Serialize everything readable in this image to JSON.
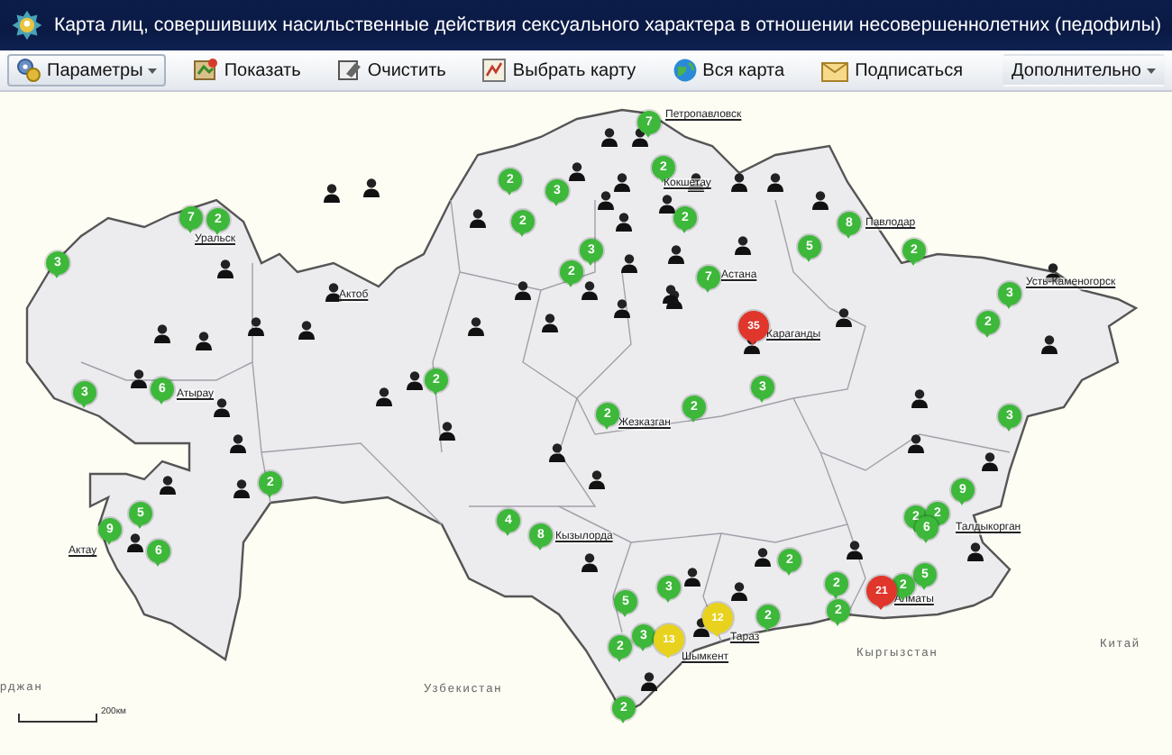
{
  "window": {
    "title": "Карта лиц, совершивших насильственные действия сексуального характера в отношении несовершеннолетних (педофилы)"
  },
  "toolbar": [
    {
      "label": "Параметры",
      "kind": "dropdown"
    },
    {
      "label": "Показать",
      "kind": "button"
    },
    {
      "label": "Очистить",
      "kind": "button"
    },
    {
      "label": "Выбрать карту",
      "kind": "button"
    },
    {
      "label": "Вся карта",
      "kind": "button"
    },
    {
      "label": "Подписаться",
      "kind": "button"
    },
    {
      "label": "Дополнительно",
      "kind": "dropdown"
    }
  ],
  "map": {
    "cities": [
      {
        "name": "Уральск"
      },
      {
        "name": "Актоб"
      },
      {
        "name": "Петропавловск"
      },
      {
        "name": "Кокшетау"
      },
      {
        "name": "Павлодар"
      },
      {
        "name": "Астана"
      },
      {
        "name": "Караганды"
      },
      {
        "name": "Усть-Каменогорск"
      },
      {
        "name": "Жезказган"
      },
      {
        "name": "Кызылорда"
      },
      {
        "name": "Талдыкорган"
      },
      {
        "name": "Алматы"
      },
      {
        "name": "Шымкент"
      },
      {
        "name": "Тараз"
      },
      {
        "name": "Атырау"
      },
      {
        "name": "Актау"
      }
    ],
    "countries": [
      {
        "name": "рджан"
      },
      {
        "name": "Узбекистан"
      },
      {
        "name": "Кыргызстан"
      },
      {
        "name": "Китай"
      }
    ],
    "scale": "200км",
    "markers": [
      {
        "count": "7",
        "color": "#3db83a"
      },
      {
        "count": "2",
        "color": "#3db83a"
      },
      {
        "count": "3",
        "color": "#3db83a"
      },
      {
        "count": "3",
        "color": "#3db83a"
      },
      {
        "count": "6",
        "color": "#3db83a"
      },
      {
        "count": "2",
        "color": "#3db83a"
      },
      {
        "count": "3",
        "color": "#3db83a"
      },
      {
        "count": "2",
        "color": "#3db83a"
      },
      {
        "count": "2",
        "color": "#3db83a"
      },
      {
        "count": "2",
        "color": "#3db83a"
      },
      {
        "count": "7",
        "color": "#3db83a"
      },
      {
        "count": "2",
        "color": "#3db83a"
      },
      {
        "count": "2",
        "color": "#3db83a"
      },
      {
        "count": "3",
        "color": "#3db83a"
      },
      {
        "count": "7",
        "color": "#3db83a"
      },
      {
        "count": "35",
        "color": "#e0362c"
      },
      {
        "count": "8",
        "color": "#3db83a"
      },
      {
        "count": "5",
        "color": "#3db83a"
      },
      {
        "count": "2",
        "color": "#3db83a"
      },
      {
        "count": "3",
        "color": "#3db83a"
      },
      {
        "count": "2",
        "color": "#3db83a"
      },
      {
        "count": "3",
        "color": "#3db83a"
      },
      {
        "count": "2",
        "color": "#3db83a"
      },
      {
        "count": "2",
        "color": "#3db83a"
      },
      {
        "count": "3",
        "color": "#3db83a"
      },
      {
        "count": "2",
        "color": "#3db83a"
      },
      {
        "count": "5",
        "color": "#3db83a"
      },
      {
        "count": "9",
        "color": "#3db83a"
      },
      {
        "count": "6",
        "color": "#3db83a"
      },
      {
        "count": "4",
        "color": "#3db83a"
      },
      {
        "count": "8",
        "color": "#3db83a"
      },
      {
        "count": "9",
        "color": "#3db83a"
      },
      {
        "count": "2",
        "color": "#3db83a"
      },
      {
        "count": "2",
        "color": "#3db83a"
      },
      {
        "count": "6",
        "color": "#3db83a"
      },
      {
        "count": "5",
        "color": "#3db83a"
      },
      {
        "count": "2",
        "color": "#3db83a"
      },
      {
        "count": "21",
        "color": "#e0362c"
      },
      {
        "count": "2",
        "color": "#3db83a"
      },
      {
        "count": "2",
        "color": "#3db83a"
      },
      {
        "count": "2",
        "color": "#3db83a"
      },
      {
        "count": "2",
        "color": "#3db83a"
      },
      {
        "count": "3",
        "color": "#3db83a"
      },
      {
        "count": "5",
        "color": "#3db83a"
      },
      {
        "count": "3",
        "color": "#3db83a"
      },
      {
        "count": "2",
        "color": "#3db83a"
      },
      {
        "count": "12",
        "color": "#e8d21e"
      },
      {
        "count": "13",
        "color": "#e8d21e"
      },
      {
        "count": "2",
        "color": "#3db83a"
      }
    ]
  }
}
